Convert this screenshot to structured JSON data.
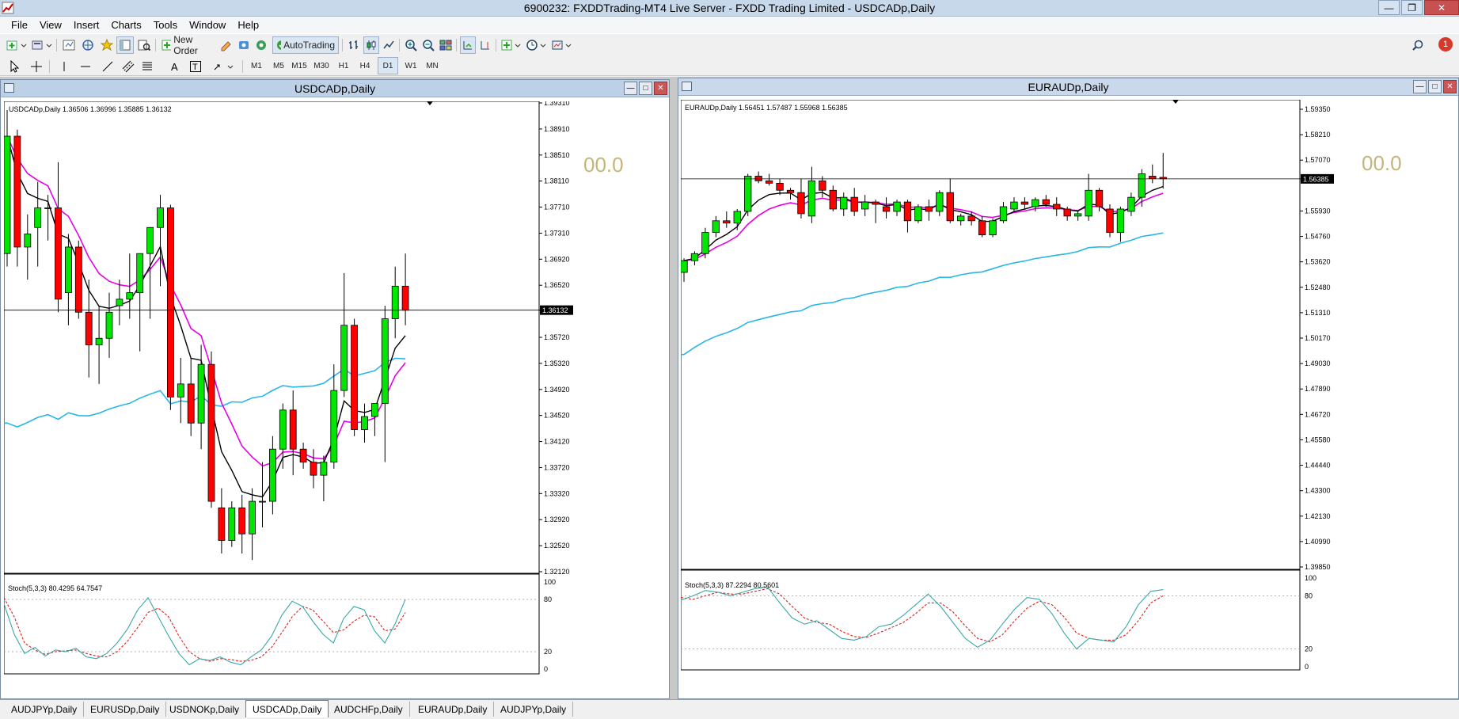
{
  "window": {
    "title": "6900232: FXDDTrading-MT4 Live Server - FXDD Trading Limited - USDCADp,Daily"
  },
  "menu": [
    "File",
    "View",
    "Insert",
    "Charts",
    "Tools",
    "Window",
    "Help"
  ],
  "toolbar": {
    "new_order": "New Order",
    "auto_trading": "AutoTrading",
    "timeframes": [
      "M1",
      "M5",
      "M15",
      "M30",
      "H1",
      "H4",
      "D1",
      "W1",
      "MN"
    ],
    "active_timeframe": "D1",
    "notification_count": "1"
  },
  "charts": [
    {
      "caption": "USDCADp,Daily",
      "info": "USDCADp,Daily  1.36506 1.36996 1.35885 1.36132",
      "current_price": "1.36132",
      "big_value": "00.0",
      "price_axis": [
        "1.39310",
        "1.38910",
        "1.38510",
        "1.38110",
        "1.37710",
        "1.37310",
        "1.36920",
        "1.36520",
        "1.36132",
        "1.35720",
        "1.35320",
        "1.34920",
        "1.34520",
        "1.34120",
        "1.33720",
        "1.33320",
        "1.32920",
        "1.32520",
        "1.32120"
      ],
      "osc_label": "Stoch(5,3,3) 80.4295 64.7547",
      "osc_axis": [
        "100",
        "80",
        "20",
        "0"
      ]
    },
    {
      "caption": "EURAUDp,Daily",
      "info": "EURAUDp,Daily  1.56451 1.57487 1.55968 1.56385",
      "current_price": "1.56385",
      "big_value": "00.0",
      "price_axis": [
        "1.59350",
        "1.58210",
        "1.57070",
        "1.56385",
        "1.55930",
        "1.54760",
        "1.53620",
        "1.52480",
        "1.51310",
        "1.50170",
        "1.49030",
        "1.47890",
        "1.46720",
        "1.45580",
        "1.44440",
        "1.43300",
        "1.42130",
        "1.40990",
        "1.39850"
      ],
      "osc_label": "Stoch(5,3,3) 87.2294 80.5601",
      "osc_axis": [
        "100",
        "80",
        "20",
        "0"
      ]
    }
  ],
  "tabs": [
    "AUDJPYp,Daily",
    "EURUSDp,Daily",
    "USDNOKp,Daily",
    "USDCADp,Daily",
    "AUDCHFp,Daily",
    "EURAUDp,Daily",
    "AUDJPYp,Daily"
  ],
  "active_tab": "USDCADp,Daily",
  "colors": {
    "bull_candle": "#00e600",
    "bear_candle": "#ff0000",
    "ma_fast": "#000000",
    "ma_mid": "#e600e6",
    "ma_slow": "#29b6e8",
    "stoch_main": "#3aa8a8",
    "stoch_signal": "#e0201b",
    "big_value": "#c4b57a"
  },
  "chart_data": [
    {
      "type": "candlestick",
      "symbol": "USDCADp",
      "timeframe": "Daily",
      "ylim": [
        1.3212,
        1.3931
      ],
      "last_close": 1.36132,
      "candles": [
        {
          "o": 1.37,
          "h": 1.392,
          "l": 1.368,
          "c": 1.388
        },
        {
          "o": 1.388,
          "h": 1.389,
          "l": 1.368,
          "c": 1.371
        },
        {
          "o": 1.371,
          "h": 1.376,
          "l": 1.366,
          "c": 1.373
        },
        {
          "o": 1.374,
          "h": 1.381,
          "l": 1.368,
          "c": 1.377
        },
        {
          "o": 1.377,
          "h": 1.379,
          "l": 1.372,
          "c": 1.377
        },
        {
          "o": 1.377,
          "h": 1.384,
          "l": 1.361,
          "c": 1.363
        },
        {
          "o": 1.364,
          "h": 1.373,
          "l": 1.359,
          "c": 1.371
        },
        {
          "o": 1.371,
          "h": 1.372,
          "l": 1.36,
          "c": 1.361
        },
        {
          "o": 1.361,
          "h": 1.366,
          "l": 1.351,
          "c": 1.356
        },
        {
          "o": 1.356,
          "h": 1.362,
          "l": 1.35,
          "c": 1.357
        },
        {
          "o": 1.357,
          "h": 1.364,
          "l": 1.354,
          "c": 1.361
        },
        {
          "o": 1.362,
          "h": 1.366,
          "l": 1.359,
          "c": 1.363
        },
        {
          "o": 1.363,
          "h": 1.37,
          "l": 1.36,
          "c": 1.364
        },
        {
          "o": 1.364,
          "h": 1.37,
          "l": 1.355,
          "c": 1.37
        },
        {
          "o": 1.37,
          "h": 1.374,
          "l": 1.36,
          "c": 1.374
        },
        {
          "o": 1.374,
          "h": 1.379,
          "l": 1.365,
          "c": 1.377
        },
        {
          "o": 1.377,
          "h": 1.3775,
          "l": 1.346,
          "c": 1.348
        },
        {
          "o": 1.348,
          "h": 1.354,
          "l": 1.344,
          "c": 1.35
        },
        {
          "o": 1.35,
          "h": 1.354,
          "l": 1.342,
          "c": 1.344
        },
        {
          "o": 1.344,
          "h": 1.356,
          "l": 1.34,
          "c": 1.353
        },
        {
          "o": 1.353,
          "h": 1.355,
          "l": 1.331,
          "c": 1.332
        },
        {
          "o": 1.331,
          "h": 1.334,
          "l": 1.324,
          "c": 1.326
        },
        {
          "o": 1.326,
          "h": 1.332,
          "l": 1.325,
          "c": 1.331
        },
        {
          "o": 1.331,
          "h": 1.333,
          "l": 1.324,
          "c": 1.327
        },
        {
          "o": 1.327,
          "h": 1.334,
          "l": 1.323,
          "c": 1.332
        },
        {
          "o": 1.332,
          "h": 1.338,
          "l": 1.328,
          "c": 1.332
        },
        {
          "o": 1.332,
          "h": 1.342,
          "l": 1.33,
          "c": 1.34
        },
        {
          "o": 1.34,
          "h": 1.347,
          "l": 1.337,
          "c": 1.346
        },
        {
          "o": 1.346,
          "h": 1.349,
          "l": 1.336,
          "c": 1.34
        },
        {
          "o": 1.34,
          "h": 1.341,
          "l": 1.337,
          "c": 1.338
        },
        {
          "o": 1.338,
          "h": 1.34,
          "l": 1.334,
          "c": 1.336
        },
        {
          "o": 1.336,
          "h": 1.339,
          "l": 1.332,
          "c": 1.338
        },
        {
          "o": 1.338,
          "h": 1.353,
          "l": 1.337,
          "c": 1.349
        },
        {
          "o": 1.349,
          "h": 1.367,
          "l": 1.348,
          "c": 1.359
        },
        {
          "o": 1.359,
          "h": 1.36,
          "l": 1.342,
          "c": 1.343
        },
        {
          "o": 1.343,
          "h": 1.347,
          "l": 1.341,
          "c": 1.345
        },
        {
          "o": 1.345,
          "h": 1.347,
          "l": 1.342,
          "c": 1.347
        },
        {
          "o": 1.347,
          "h": 1.362,
          "l": 1.338,
          "c": 1.36
        },
        {
          "o": 1.36,
          "h": 1.368,
          "l": 1.357,
          "c": 1.365
        },
        {
          "o": 1.365,
          "h": 1.37,
          "l": 1.359,
          "c": 1.3613
        }
      ],
      "oscillator": {
        "name": "Stoch(5,3,3)",
        "ylim": [
          0,
          100
        ],
        "levels": [
          20,
          80
        ],
        "main": [
          75,
          40,
          18,
          25,
          15,
          22,
          20,
          24,
          14,
          12,
          18,
          30,
          46,
          68,
          82,
          60,
          38,
          18,
          5,
          12,
          10,
          14,
          8,
          5,
          14,
          22,
          38,
          62,
          78,
          72,
          55,
          40,
          30,
          58,
          72,
          68,
          44,
          30,
          52,
          80
        ],
        "signal": [
          82,
          60,
          30,
          22,
          17,
          20,
          21,
          22,
          18,
          15,
          14,
          20,
          32,
          48,
          65,
          70,
          60,
          38,
          20,
          12,
          9,
          12,
          11,
          9,
          10,
          14,
          25,
          42,
          60,
          72,
          68,
          55,
          42,
          45,
          55,
          62,
          60,
          44,
          46,
          65
        ]
      }
    },
    {
      "type": "candlestick",
      "symbol": "EURAUDp",
      "timeframe": "Daily",
      "ylim": [
        1.3985,
        1.5935
      ],
      "last_close": 1.56385,
      "candles": [
        {
          "o": 1.524,
          "h": 1.53,
          "l": 1.52,
          "c": 1.529
        },
        {
          "o": 1.529,
          "h": 1.533,
          "l": 1.527,
          "c": 1.532
        },
        {
          "o": 1.532,
          "h": 1.543,
          "l": 1.53,
          "c": 1.541
        },
        {
          "o": 1.541,
          "h": 1.548,
          "l": 1.539,
          "c": 1.546
        },
        {
          "o": 1.546,
          "h": 1.55,
          "l": 1.543,
          "c": 1.545
        },
        {
          "o": 1.545,
          "h": 1.551,
          "l": 1.542,
          "c": 1.55
        },
        {
          "o": 1.55,
          "h": 1.566,
          "l": 1.548,
          "c": 1.565
        },
        {
          "o": 1.565,
          "h": 1.567,
          "l": 1.562,
          "c": 1.563
        },
        {
          "o": 1.563,
          "h": 1.566,
          "l": 1.561,
          "c": 1.562
        },
        {
          "o": 1.562,
          "h": 1.564,
          "l": 1.557,
          "c": 1.559
        },
        {
          "o": 1.559,
          "h": 1.56,
          "l": 1.555,
          "c": 1.558
        },
        {
          "o": 1.558,
          "h": 1.564,
          "l": 1.547,
          "c": 1.549
        },
        {
          "o": 1.548,
          "h": 1.569,
          "l": 1.545,
          "c": 1.563
        },
        {
          "o": 1.563,
          "h": 1.565,
          "l": 1.556,
          "c": 1.559
        },
        {
          "o": 1.559,
          "h": 1.561,
          "l": 1.55,
          "c": 1.551
        },
        {
          "o": 1.551,
          "h": 1.558,
          "l": 1.548,
          "c": 1.556
        },
        {
          "o": 1.556,
          "h": 1.56,
          "l": 1.548,
          "c": 1.55
        },
        {
          "o": 1.551,
          "h": 1.557,
          "l": 1.548,
          "c": 1.554
        },
        {
          "o": 1.554,
          "h": 1.555,
          "l": 1.545,
          "c": 1.553
        },
        {
          "o": 1.552,
          "h": 1.556,
          "l": 1.547,
          "c": 1.55
        },
        {
          "o": 1.55,
          "h": 1.555,
          "l": 1.548,
          "c": 1.554
        },
        {
          "o": 1.554,
          "h": 1.555,
          "l": 1.541,
          "c": 1.546
        },
        {
          "o": 1.546,
          "h": 1.553,
          "l": 1.545,
          "c": 1.552
        },
        {
          "o": 1.552,
          "h": 1.555,
          "l": 1.546,
          "c": 1.55
        },
        {
          "o": 1.55,
          "h": 1.559,
          "l": 1.548,
          "c": 1.558
        },
        {
          "o": 1.558,
          "h": 1.564,
          "l": 1.545,
          "c": 1.546
        },
        {
          "o": 1.546,
          "h": 1.549,
          "l": 1.544,
          "c": 1.548
        },
        {
          "o": 1.548,
          "h": 1.55,
          "l": 1.544,
          "c": 1.546
        },
        {
          "o": 1.546,
          "h": 1.548,
          "l": 1.539,
          "c": 1.54
        },
        {
          "o": 1.54,
          "h": 1.547,
          "l": 1.539,
          "c": 1.546
        },
        {
          "o": 1.546,
          "h": 1.554,
          "l": 1.545,
          "c": 1.552
        },
        {
          "o": 1.551,
          "h": 1.556,
          "l": 1.55,
          "c": 1.554
        },
        {
          "o": 1.554,
          "h": 1.556,
          "l": 1.551,
          "c": 1.553
        },
        {
          "o": 1.552,
          "h": 1.556,
          "l": 1.55,
          "c": 1.555
        },
        {
          "o": 1.555,
          "h": 1.557,
          "l": 1.552,
          "c": 1.553
        },
        {
          "o": 1.553,
          "h": 1.556,
          "l": 1.548,
          "c": 1.551
        },
        {
          "o": 1.551,
          "h": 1.552,
          "l": 1.546,
          "c": 1.548
        },
        {
          "o": 1.548,
          "h": 1.55,
          "l": 1.546,
          "c": 1.549
        },
        {
          "o": 1.548,
          "h": 1.566,
          "l": 1.546,
          "c": 1.559
        },
        {
          "o": 1.559,
          "h": 1.56,
          "l": 1.55,
          "c": 1.552
        },
        {
          "o": 1.551,
          "h": 1.553,
          "l": 1.539,
          "c": 1.541
        },
        {
          "o": 1.541,
          "h": 1.552,
          "l": 1.537,
          "c": 1.551
        },
        {
          "o": 1.55,
          "h": 1.558,
          "l": 1.548,
          "c": 1.556
        },
        {
          "o": 1.556,
          "h": 1.568,
          "l": 1.552,
          "c": 1.566
        },
        {
          "o": 1.565,
          "h": 1.57,
          "l": 1.562,
          "c": 1.564
        },
        {
          "o": 1.5645,
          "h": 1.5749,
          "l": 1.5597,
          "c": 1.5639
        }
      ],
      "oscillator": {
        "name": "Stoch(5,3,3)",
        "ylim": [
          0,
          100
        ],
        "levels": [
          20,
          80
        ],
        "main": [
          75,
          80,
          86,
          84,
          80,
          84,
          88,
          90,
          72,
          55,
          48,
          52,
          42,
          32,
          30,
          34,
          45,
          48,
          58,
          70,
          82,
          68,
          50,
          32,
          22,
          30,
          48,
          65,
          78,
          76,
          60,
          38,
          20,
          32,
          30,
          28,
          45,
          70,
          85,
          87
        ],
        "signal": [
          78,
          76,
          80,
          84,
          82,
          82,
          85,
          88,
          82,
          68,
          55,
          50,
          48,
          40,
          34,
          33,
          38,
          44,
          50,
          60,
          72,
          72,
          62,
          46,
          32,
          28,
          36,
          52,
          66,
          74,
          70,
          56,
          38,
          32,
          30,
          30,
          36,
          52,
          72,
          80
        ]
      }
    }
  ]
}
